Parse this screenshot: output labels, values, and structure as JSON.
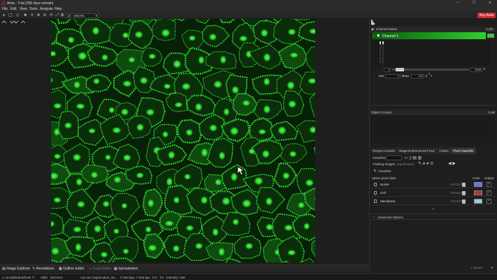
{
  "window": {
    "title": "Aivia - Trial (296 days remain)",
    "controls": {
      "minimize": "–",
      "maximize": "☐",
      "close": "✕"
    }
  },
  "menu": [
    "File",
    "Edit",
    "View",
    "Tools",
    "Analysis",
    "Help"
  ],
  "toolbar": {
    "zoom_value": "1X - 400.0%",
    "buy_label": "Buy Aivia",
    "icons": [
      "select-icon",
      "region-icon",
      "eraser-icon",
      "save-icon",
      "crop-icon",
      "zoom-in-icon",
      "zoom-out-icon",
      "rotate-icon",
      "fit-icon",
      "actual-size-icon"
    ]
  },
  "bottom_tabs": [
    "Image Explorer",
    "Annotations",
    "Outline Editor",
    "Track Editor",
    "Spreadsheet"
  ],
  "status": {
    "layer": "1: Uncalibrated/Pixel",
    "bitdepth": "16bit",
    "size": "512×512",
    "filename": "can see Gap/unction_Se...",
    "coords": "X:364.5px, Y:305.5px",
    "zt": "Z:0",
    "t": "T:0",
    "intensity": "Intensity: 198"
  },
  "channels": {
    "header_name": "Channel Name",
    "header_color": "Color",
    "channel_label": "Channel 1",
    "channel_color": "#19e019",
    "range_min_field": "0",
    "range_max_field": "4558",
    "min_label": "Min",
    "min_value": "0",
    "max_label": "Max",
    "max_value": "142"
  },
  "object_groups": {
    "header": "Object Groups",
    "color_header": "Color"
  },
  "tabs": [
    "Recipe Console",
    "Image Enhancement Tool",
    "Charts",
    "Pixel Classifier"
  ],
  "active_tab": "Pixel Classifier",
  "classifier": {
    "label": "Classifier",
    "training_images_label": "Training Images",
    "input_output_label": "Input/Output",
    "section_label": "Classifier",
    "select_pixel_class": "Select pixel class",
    "color_col": "Color",
    "output_col": "Output",
    "classes": [
      {
        "name": "Nuclei",
        "color": "#6b72f0",
        "output": "✓"
      },
      {
        "name": "Cell",
        "color": "#b83232",
        "output": "✓"
      },
      {
        "name": "Membrane",
        "color": "#9cc7ea",
        "output": "✓"
      }
    ],
    "advanced_options": "Advanced Options"
  },
  "search_placeholder": "Search"
}
